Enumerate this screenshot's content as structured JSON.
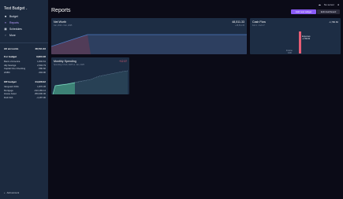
{
  "sidebar": {
    "budget_name": "Test Budget",
    "nav": [
      {
        "icon": "■",
        "label": "Budget"
      },
      {
        "icon": "≡",
        "label": "Reports"
      },
      {
        "icon": "▦",
        "label": "Schedules"
      },
      {
        "icon": "›",
        "label": "More"
      }
    ],
    "all_accounts": {
      "label": "All accounts",
      "value": "48,511.33"
    },
    "for_budget": {
      "label": "For budget",
      "value": "3,903.18"
    },
    "budget_accounts": [
      {
        "name": "Bank of America",
        "value": "1,832.61"
      },
      {
        "name": "Ally Savings",
        "value": "2,504.79"
      },
      {
        "name": "Capital One Checking",
        "value": "-580.60"
      },
      {
        "name": "HSBC",
        "value": "-304.90"
      }
    ],
    "off_budget": {
      "label": "Off budget",
      "value": "44,328.02"
    },
    "off_budget_accounts": [
      {
        "name": "Vanguard 401k",
        "value": "1,870.36"
      },
      {
        "name": "Mortgage",
        "value": "-193,183.14"
      },
      {
        "name": "House Asset",
        "value": "250,000.00"
      },
      {
        "name": "Roth IRA",
        "value": "-4,187.96"
      }
    ],
    "add_account": "Add account"
  },
  "header": {
    "title": "Reports",
    "sync_label": "No server",
    "add_widget": "Add new widget",
    "edit_dashboard": "Edit dashboard"
  },
  "cards": {
    "net_worth": {
      "title": "Net Worth",
      "subtitle": "Jan, 2024 - Feb, 2025",
      "value": "48,511.33",
      "value_sub": "+48,511.33"
    },
    "cash_flow": {
      "title": "Cash Flow",
      "subtitle": "Feb 1 - Feb 17",
      "value": "-1,780.60",
      "expenses_label": "Expenses",
      "expenses_value": "-1,780.60",
      "income_label": "Income",
      "income_value": "0.00"
    },
    "monthly_spending": {
      "title": "Monthly Spending",
      "subtitle": "Spending in Feb, 2025 vs. Jan, 2025",
      "change": "+12.37"
    }
  },
  "colors": {
    "accent": "#8b5cf6",
    "card": "#1d2d44",
    "sidebar": "#1c2a3f",
    "expenses": "#e85d75"
  }
}
